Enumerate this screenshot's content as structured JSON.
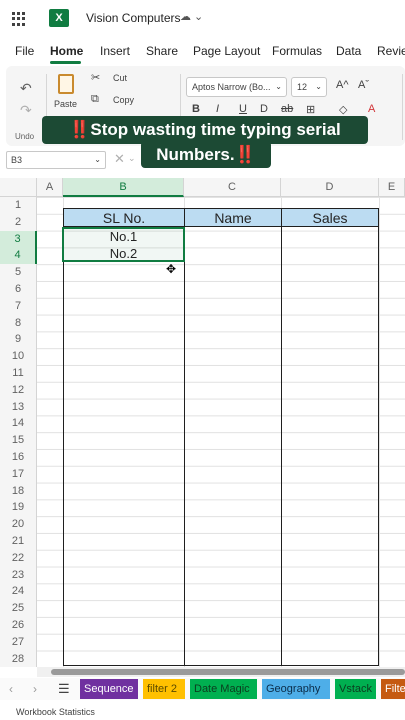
{
  "app": {
    "title": "Vision Computers",
    "icons": [
      "waffle-icon",
      "excel-logo-icon",
      "cloud-sync-icon",
      "chevron-down-icon"
    ]
  },
  "tabs": [
    "File",
    "Home",
    "Insert",
    "Share",
    "Page Layout",
    "Formulas",
    "Data",
    "Review"
  ],
  "ribbon": {
    "undo_label": "Undo",
    "paste_label": "Paste",
    "cut_label": "Cut",
    "copy_label": "Copy",
    "font_name": "Aptos Narrow (Bo...",
    "font_size": "12",
    "grow_font": "A^",
    "shrink_font": "Aˇ",
    "format_buttons": [
      "B",
      "I",
      "U",
      "D",
      "ab",
      "⊞",
      "◇",
      "A"
    ]
  },
  "banner": {
    "line1_text": "Stop wasting time typing serial",
    "line2_text": "Numbers.",
    "emoji": "‼️"
  },
  "formula_bar": {
    "name_box": "B3"
  },
  "sheet": {
    "columns": [
      "A",
      "B",
      "C",
      "D",
      "E"
    ],
    "rows": [
      "1",
      "2",
      "3",
      "4",
      "5",
      "6",
      "7",
      "8",
      "9",
      "10",
      "11",
      "12",
      "13",
      "14",
      "15",
      "16",
      "17",
      "18",
      "19",
      "20",
      "21",
      "22",
      "23",
      "24",
      "25",
      "26",
      "27",
      "28"
    ],
    "headers": [
      "SL No.",
      "Name",
      "Sales"
    ],
    "values": [
      "No.1",
      "No.2"
    ]
  },
  "sheet_tabs": [
    {
      "name": "Sequence",
      "color": "#7030a0",
      "text_color": "#ffffff"
    },
    {
      "name": "filter 2",
      "color": "#ffc000",
      "text_color": "#5a4a00"
    },
    {
      "name": "Date Magic",
      "color": "#00b050",
      "text_color": "#0b3d1f"
    },
    {
      "name": "Geography",
      "color": "#4eaee8",
      "text_color": "#0b2d4a"
    },
    {
      "name": "Vstack",
      "color": "#00b050",
      "text_color": "#0b3d1f"
    },
    {
      "name": "Filte",
      "color": "#c55a11",
      "text_color": "#ffffff"
    }
  ],
  "status": {
    "text": "Workbook Statistics"
  }
}
